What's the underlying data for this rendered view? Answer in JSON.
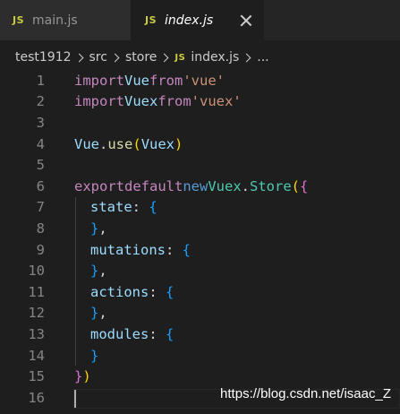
{
  "tabs": [
    {
      "icon": "JS",
      "label": "main.js",
      "active": false
    },
    {
      "icon": "JS",
      "label": "index.js",
      "active": true
    }
  ],
  "breadcrumb": {
    "items": [
      "test1912",
      "src",
      "store"
    ],
    "file_icon": "JS",
    "file": "index.js",
    "more": "..."
  },
  "editor": {
    "line_numbers": [
      "1",
      "2",
      "3",
      "4",
      "5",
      "6",
      "7",
      "8",
      "9",
      "10",
      "11",
      "12",
      "13",
      "14",
      "15",
      "16"
    ],
    "tokens": {
      "l1": [
        "import",
        "Vue",
        "from",
        "'vue'"
      ],
      "l2": [
        "import",
        "Vuex",
        "from",
        "'vuex'"
      ],
      "l4": [
        "Vue",
        ".",
        "use",
        "(",
        "Vuex",
        ")"
      ],
      "l6": [
        "export",
        "default",
        "new",
        "Vuex",
        ".",
        "Store",
        "(",
        "{"
      ],
      "l7": [
        "state",
        ": ",
        "{"
      ],
      "l8": [
        "}",
        ","
      ],
      "l9": [
        "mutations",
        ": ",
        "{"
      ],
      "l10": [
        "}",
        ","
      ],
      "l11": [
        "actions",
        ": ",
        "{"
      ],
      "l12": [
        "}",
        ","
      ],
      "l13": [
        "modules",
        ": ",
        "{"
      ],
      "l14": [
        "}"
      ],
      "l15": [
        "}",
        ")"
      ]
    }
  },
  "watermark": "https://blog.csdn.net/isaac_Z"
}
